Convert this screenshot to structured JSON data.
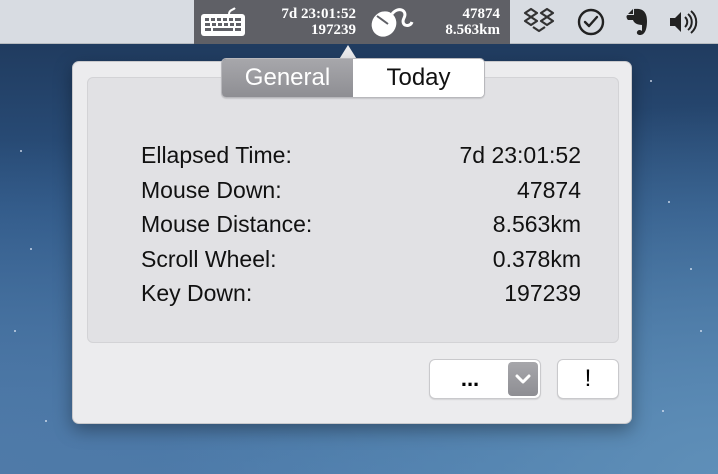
{
  "menubar": {
    "elapsed_short": "7d 23:01:52",
    "key_count": "197239",
    "mouse_down": "47874",
    "mouse_distance": "8.563km",
    "icons": [
      "keyboard-icon",
      "mouse-icon",
      "dropbox-icon",
      "clock-icon",
      "evernote-icon",
      "volume-icon"
    ]
  },
  "popover": {
    "tabs": [
      {
        "label": "General",
        "active": true
      },
      {
        "label": "Today",
        "active": false
      }
    ],
    "stats": [
      {
        "label": "Ellapsed Time:",
        "value": "7d 23:01:52"
      },
      {
        "label": "Mouse Down:",
        "value": "47874"
      },
      {
        "label": "Mouse Distance:",
        "value": "8.563km"
      },
      {
        "label": "Scroll Wheel:",
        "value": "0.378km"
      },
      {
        "label": "Key Down:",
        "value": "197239"
      }
    ],
    "dropdown_label": "...",
    "alert_button_label": "!"
  }
}
